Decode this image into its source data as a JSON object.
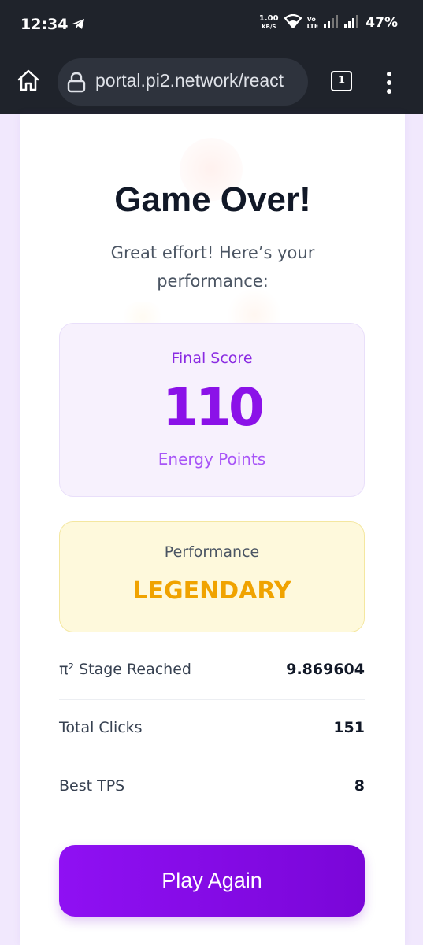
{
  "status_bar": {
    "time": "12:34",
    "speed_value": "1.00",
    "speed_unit": "KB/S",
    "volte_line1": "Vo",
    "volte_line2": "LTE",
    "battery": "47%"
  },
  "browser": {
    "url": "portal.pi2.network/react",
    "tab_count": "1"
  },
  "game": {
    "title": "Game Over!",
    "subtitle": "Great effort! Here’s your performance:",
    "score": {
      "label": "Final Score",
      "value": "110",
      "unit": "Energy Points"
    },
    "performance": {
      "label": "Performance",
      "rating": "LEGENDARY"
    },
    "stats": [
      {
        "label": "π² Stage Reached",
        "value": "9.869604"
      },
      {
        "label": "Total Clicks",
        "value": "151"
      },
      {
        "label": "Best TPS",
        "value": "8"
      }
    ],
    "play_again": "Play Again"
  },
  "colors": {
    "accent": "#8b12e8",
    "rating": "#f0a300",
    "browser_bg": "#1f232b",
    "page_bg": "#f1e8fd"
  }
}
